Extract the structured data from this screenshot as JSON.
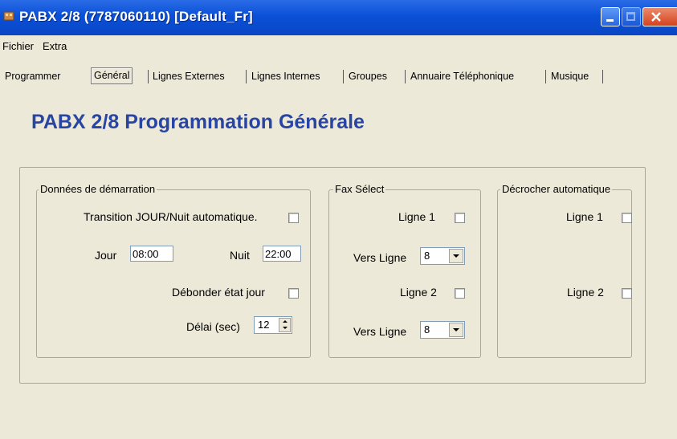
{
  "window": {
    "title": "PABX 2/8 (7787060110) [Default_Fr]"
  },
  "menu": {
    "items": [
      "Fichier",
      "Extra"
    ]
  },
  "tabs": [
    "Programmer",
    "Général",
    "Lignes Externes",
    "Lignes Internes",
    "Groupes",
    "Annuaire Téléphonique",
    "Musique"
  ],
  "active_tab": "Général",
  "page": {
    "heading": "PABX 2/8 Programmation Générale"
  },
  "demarrage": {
    "title": "Données de démarration",
    "transition_label": "Transition JOUR/Nuit automatique.",
    "jour_label": "Jour",
    "jour_value": "08:00",
    "nuit_label": "Nuit",
    "nuit_value": "22:00",
    "debonder_label": "Débonder état jour",
    "delai_label": "Délai (sec)",
    "delai_value": "12"
  },
  "fax": {
    "title": "Fax Sélect",
    "ligne1_label": "Ligne 1",
    "vers1_label": "Vers Ligne",
    "vers1_value": "8",
    "ligne2_label": "Ligne 2",
    "vers2_label": "Vers Ligne",
    "vers2_value": "8"
  },
  "decrocher": {
    "title": "Décrocher automatique",
    "ligne1_label": "Ligne 1",
    "ligne2_label": "Ligne 2"
  },
  "colors": {
    "titlebar": "#0a50d8",
    "heading": "#2845a4",
    "window_bg": "#ece9d8"
  }
}
